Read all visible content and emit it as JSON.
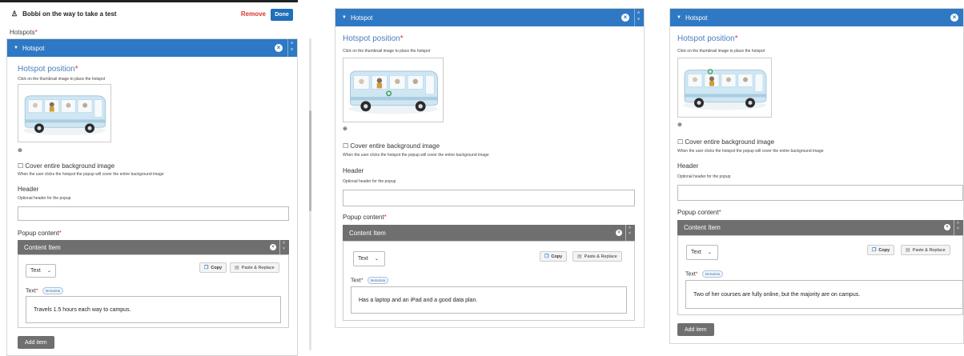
{
  "panel1": {
    "topbar": {
      "title": "Bobbi on the way to take a test",
      "remove": "Remove",
      "done": "Done"
    },
    "hotspots_label": "Hotspots",
    "hotspot_header": "Hotspot",
    "position_title": "Hotspot position",
    "position_hint": "Click on the thumbnail image to place the hotspot",
    "cover_label": "Cover entire background image",
    "cover_desc": "When the user clicks the hotspot the popup will cover the entire background image",
    "header_label": "Header",
    "header_hint": "Optional header for the popup",
    "header_value": "",
    "popup_label": "Popup content",
    "content_item": "Content Item",
    "select_value": "Text",
    "copy": "Copy",
    "paste": "Paste & Replace",
    "text_label": "Text",
    "metadata": "Metadata",
    "text_value": "Travels 1.5 hours each way to campus.",
    "add_item": "Add item"
  },
  "panel2": {
    "hotspot_header": "Hotspot",
    "position_title": "Hotspot position",
    "position_hint": "Click on the thumbnail image to place the hotspot",
    "cover_label": "Cover entire background image",
    "cover_desc": "When the user clicks the hotspot the popup will cover the entire background image",
    "header_label": "Header",
    "header_hint": "Optional header for the popup",
    "popup_label": "Popup content",
    "content_item": "Content Item",
    "select_value": "Text",
    "copy": "Copy",
    "paste": "Paste & Replace",
    "text_label": "Text",
    "metadata": "Metadata",
    "text_value": "Has a laptop and an iPad and a good data plan."
  },
  "panel3": {
    "hotspot_header": "Hotspot",
    "position_title": "Hotspot position",
    "position_hint": "Click on the thumbnail image to place the hotspot",
    "cover_label": "Cover entire background image",
    "cover_desc": "When the user clicks the hotspot the popup will cover the entire background image",
    "header_label": "Header",
    "header_hint": "Optional header for the popup",
    "popup_label": "Popup content",
    "content_item": "Content Item",
    "select_value": "Text",
    "copy": "Copy",
    "paste": "Paste & Replace",
    "text_label": "Text",
    "metadata": "Metadata",
    "text_value": "Two of her courses are fully online, but the majority are on campus.",
    "add_item": "Add item"
  },
  "icons": {
    "person": "person-icon",
    "close": "close-circle-icon",
    "reorder": "reorder-arrows-icon",
    "zoom": "zoom-in-icon",
    "copy": "copy-icon",
    "paste": "paste-icon",
    "caret": "caret-down-icon"
  },
  "colors": {
    "header_blue": "#2f78c4",
    "content_gray": "#6f6f6f",
    "required_red": "#d9362b",
    "done_blue": "#1f6fba"
  }
}
